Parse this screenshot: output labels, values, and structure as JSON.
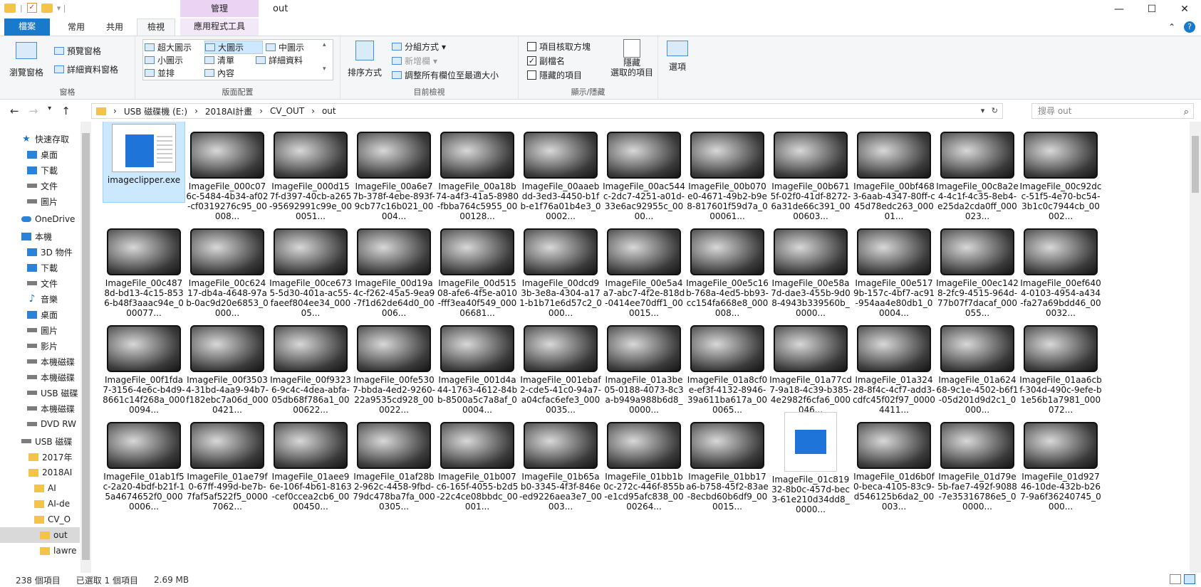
{
  "titlebar": {
    "context_tab": "管理",
    "title": "out",
    "minimize": "—",
    "maximize": "☐",
    "close": "✕"
  },
  "tabs": {
    "file": "檔案",
    "home": "常用",
    "share": "共用",
    "view": "檢視",
    "app_tools": "應用程式工具"
  },
  "ribbon": {
    "panes": {
      "label": "窗格",
      "nav_pane": "瀏覽窗格",
      "preview_pane": "預覽窗格",
      "details_pane": "詳細資料窗格"
    },
    "layout": {
      "label": "版面配置",
      "xl_icons": "超大圖示",
      "large_icons": "大圖示",
      "medium_icons": "中圖示",
      "small_icons": "小圖示",
      "list": "清單",
      "details": "詳細資料",
      "tiles": "並排",
      "content": "內容"
    },
    "current_view": {
      "label": "目前檢視",
      "sort_by": "排序方式",
      "group_by": "分組方式",
      "add_columns": "新增欄",
      "size_all_columns": "調整所有欄位至最適大小"
    },
    "show_hide": {
      "label": "顯示/隱藏",
      "item_checkboxes": "項目核取方塊",
      "file_extensions": "副檔名",
      "hidden_items": "隱藏的項目",
      "hide_selected_1": "隱藏",
      "hide_selected_2": "選取的項目",
      "options": "選項"
    }
  },
  "address": {
    "path": [
      "USB 磁碟機 (E:)",
      "2018AI計畫",
      "CV_OUT",
      "out"
    ],
    "search_placeholder": "搜尋 out"
  },
  "nav": {
    "items": [
      {
        "label": "快速存取",
        "icon": "star-icon"
      },
      {
        "label": "桌面",
        "icon": "desktop-icon"
      },
      {
        "label": "下載",
        "icon": "download-icon"
      },
      {
        "label": "文件",
        "icon": "documents-icon"
      },
      {
        "label": "圖片",
        "icon": "pictures-icon"
      },
      {
        "label": "OneDrive",
        "icon": "cloud-icon"
      },
      {
        "label": "本機",
        "icon": "computer-icon"
      },
      {
        "label": "3D 物件",
        "icon": "3d-objects-icon"
      },
      {
        "label": "下載",
        "icon": "download-icon"
      },
      {
        "label": "文件",
        "icon": "documents-icon"
      },
      {
        "label": "音樂",
        "icon": "music-icon"
      },
      {
        "label": "桌面",
        "icon": "desktop-icon"
      },
      {
        "label": "圖片",
        "icon": "pictures-icon"
      },
      {
        "label": "影片",
        "icon": "video-icon"
      },
      {
        "label": "本機磁碟",
        "icon": "drive-icon"
      },
      {
        "label": "本機磁碟",
        "icon": "drive-icon"
      },
      {
        "label": "USB 磁碟",
        "icon": "usb-drive-icon"
      },
      {
        "label": "本機磁碟",
        "icon": "drive-icon"
      },
      {
        "label": "DVD RW",
        "icon": "dvd-icon"
      },
      {
        "label": "USB 磁碟",
        "icon": "usb-drive-icon"
      },
      {
        "label": "2017年",
        "icon": "folder-icon"
      },
      {
        "label": "2018AI",
        "icon": "folder-icon"
      },
      {
        "label": "AI",
        "icon": "folder-icon"
      },
      {
        "label": "AI-de",
        "icon": "folder-icon"
      },
      {
        "label": "CV_O",
        "icon": "folder-icon"
      },
      {
        "label": "out",
        "icon": "folder-icon"
      },
      {
        "label": "lawre",
        "icon": "folder-icon"
      }
    ]
  },
  "files": [
    "imageclipper.exe",
    "ImageFile_000c076c-5484-4b34-af02-cf0319276c95_00008...",
    "ImageFile_000d157f-d397-40cb-a265-95692991c99e_000051...",
    "ImageFile_00a6e77b-378f-4ebe-893f-9cb77c16b021_00004...",
    "ImageFile_00a18b74-a4f3-41a5-8980-fbba764c5955_0000128...",
    "ImageFile_00aaebdd-3ed3-4450-b1fb-e1f76a01b4e3_00002...",
    "ImageFile_00ac544c-2dc7-4251-a01d-33e6ac92955c_0000...",
    "ImageFile_00b070e0-4671-49b2-b9e8-817601f59d7a_000061...",
    "ImageFile_00b6715f-02f0-41df-8272-6a31de66c391_0000603...",
    "ImageFile_00bf4683-6aab-4347-80ff-c45d78edc263_00001...",
    "ImageFile_00c8a2e4-4c1f-4c35-8eb4-e25da2cda0ff_000023...",
    "ImageFile_00c92dcc-51f5-4e70-bc54-3b1c0c7944cb_00002...",
    "ImageFile_00c4878d-bd13-4c15-8536-b48f3aaac94e_000077...",
    "ImageFile_00c62417-db4a-4648-97ab-0ac9d20e6853_0000...",
    "ImageFile_00ce6735-5d30-401a-ac55-faeef804ee34_00005...",
    "ImageFile_00d19a4c-f262-45a5-9ea9-7f1d62de64d0_00006...",
    "ImageFile_00d51508-afe6-4f5e-a010-fff3ea40f549_00006681...",
    "ImageFile_00dcd93b-3e8a-4304-a171-b1b71e6d57c2_0000...",
    "ImageFile_00e5a4a7-abc7-4f2e-818d-0414ee70dff1_000015...",
    "ImageFile_00e5c16b-768a-4ed5-bb93-cc154fa668e8_000008...",
    "ImageFile_00e58a7d-dae3-455b-9d08-4943b339560b_0000...",
    "ImageFile_00e5179b-157c-4bf7-ac91-954aa4e80db1_00004...",
    "ImageFile_00ec1428-2fc9-4515-964d-77b07f7dacaf_000055...",
    "ImageFile_00ef6404-0103-4954-a434-fa27a69bdd46_000032...",
    "ImageFile_00f1fda7-3156-4e6c-b4d9-8661c14f268a_0000094...",
    "ImageFile_00f35034-31bd-4aa9-94b7-f182ebc7a06d_0000421...",
    "ImageFile_00f93236-9c4c-4dea-abfa-05db68f786a1_0000622...",
    "ImageFile_00fe5307-bbda-4ed2-9260-22a9535cd928_000022...",
    "ImageFile_001d4a44-1763-4612-84bb-8500a5c7a8af_00004...",
    "ImageFile_001ebaf2-cde5-41c0-94a7-a04cfac6efe3_0000035...",
    "ImageFile_01a3be05-0188-4073-8c3a-b949a988b6d8_0000...",
    "ImageFile_01a8cf0e-ef3f-4132-8946-39a611ba617a_000065...",
    "ImageFile_01a77cd7-9a18-4c39-b385-4e2982f6cfa6_000046...",
    "ImageFile_01a32428-8f4c-4cf7-add3-cdfc45f02f97_00004411...",
    "ImageFile_01a62468-9c1e-4502-b6f1-05d201d9d2c1_0000...",
    "ImageFile_01aa6cbf-304d-490c-9efe-b1e56b1a7981_000072...",
    "ImageFile_01ab1f5c-2a20-4bdf-b21f-15a4674652f0_0000006...",
    "ImageFile_01ae79f0-67ff-499d-be7b-7faf5af522f5_00007062...",
    "ImageFile_01aee96e-106f-4b61-8163-cef0ccea2cb6_0000450...",
    "ImageFile_01af28b2-962c-4458-9fbd-79dc478ba7fa_0000305...",
    "ImageFile_01b007c6-165f-4055-b2d5-22c4ce08bbdc_00001...",
    "ImageFile_01b65ab0-3345-4f3f-846e-ed9226aea3e7_00003...",
    "ImageFile_01bb1b0c-272c-446f-855b-e1cd95afc838_0000264...",
    "ImageFile_01bb17a6-b758-45f2-83ae-8ecbd60b6df9_000015...",
    "ImageFile_01c81932-8b0c-457d-bec3-61e210d34dd8_0000...",
    "ImageFile_01d6b0f0-beca-4105-83c9-d546125b6da2_00003...",
    "ImageFile_01d79e5b-fae7-492f-9088-7e35316786e5_00000...",
    "ImageFile_01d92746-10de-432b-b267-9a6f36240745_0000..."
  ],
  "status": {
    "count": "238 個項目",
    "selected": "已選取 1 個項目",
    "size": "2.69 MB"
  }
}
